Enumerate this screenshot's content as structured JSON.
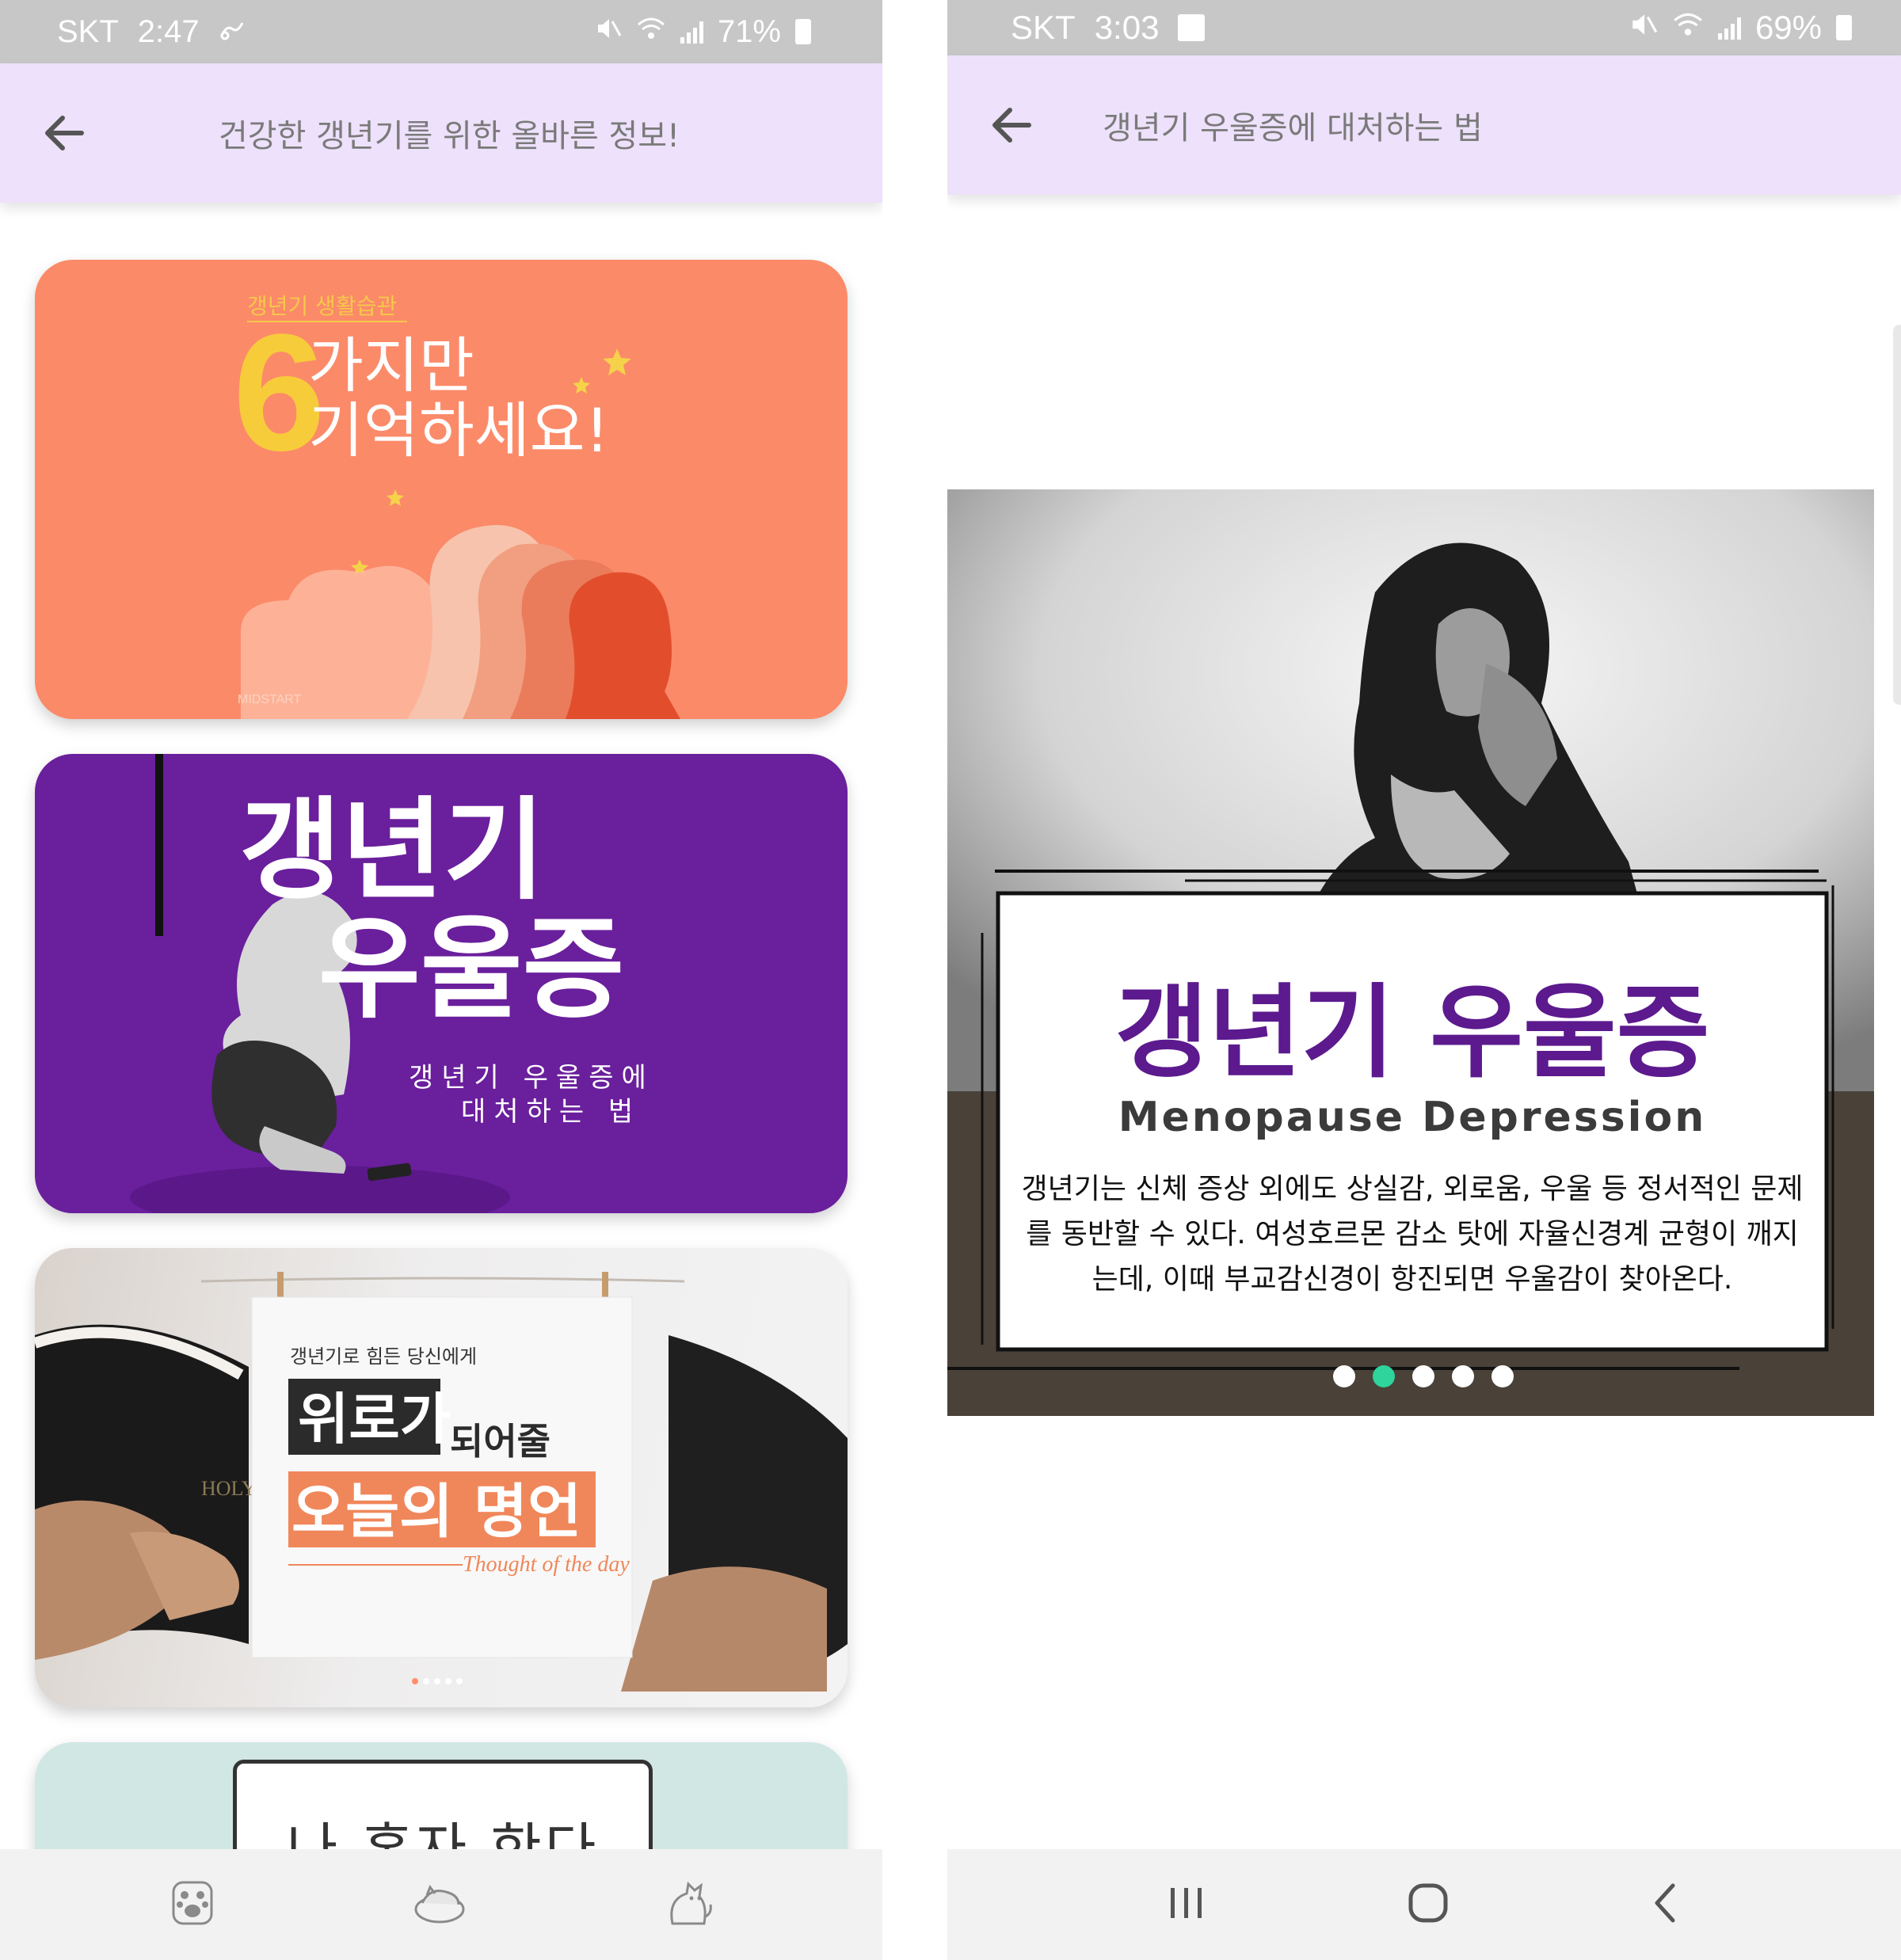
{
  "left_screen": {
    "status_bar": {
      "carrier": "SKT",
      "time": "2:47",
      "battery": "71%"
    },
    "app_bar": {
      "title": "건강한 갱년기를 위한 올바른 정보!"
    },
    "cards": [
      {
        "small_title": "갱년기 생활습관",
        "big_number": "6",
        "line1": "가지만",
        "line2": "기억하세요!",
        "brand": "MIDSTART"
      },
      {
        "title_line1": "갱년기",
        "title_line2": "우울증",
        "subtitle_line1": "갱년기 우울증에",
        "subtitle_line2": "대처하는 법"
      },
      {
        "kicker": "갱년기로 힘든 당신에게",
        "highlight": "위로가",
        "line1_rest": "되어줄",
        "line2": "오늘의 명언",
        "signature": "Thought of the day",
        "book_text": "HOLY BIBLE"
      },
      {
        "text": "나 혼자 한다"
      }
    ],
    "bottom_nav": [
      "paw-icon",
      "sleeping-cat-icon",
      "cat-icon"
    ]
  },
  "right_screen": {
    "status_bar": {
      "carrier": "SKT",
      "time": "3:03",
      "battery": "69%"
    },
    "app_bar": {
      "title": "갱년기 우울증에 대처하는 법"
    },
    "slide": {
      "headline": "갱년기 우울증",
      "subheadline": "Menopause Depression",
      "body_line1": "갱년기는 신체 증상 외에도 상실감, 외로움, 우울 등 정서적인 문제",
      "body_line2": "를 동반할 수 있다. 여성호르몬 감소 탓에 자율신경계 균형이 깨지",
      "body_line3": "는데, 이때 부교감신경이 항진되면 우울감이 찾아온다.",
      "page_count": 5,
      "active_page": 2
    },
    "bottom_nav": [
      "recent-apps-icon",
      "home-icon",
      "back-icon"
    ]
  },
  "colors": {
    "status_bar": "#c7c7c7",
    "app_bar": "#ede1fb",
    "card_orange": "#fb8a69",
    "card_purple": "#6a1f9c",
    "card_mint": "#d1e7e4",
    "headline_purple": "#5c1a8e",
    "active_dot": "#2ed49b"
  }
}
